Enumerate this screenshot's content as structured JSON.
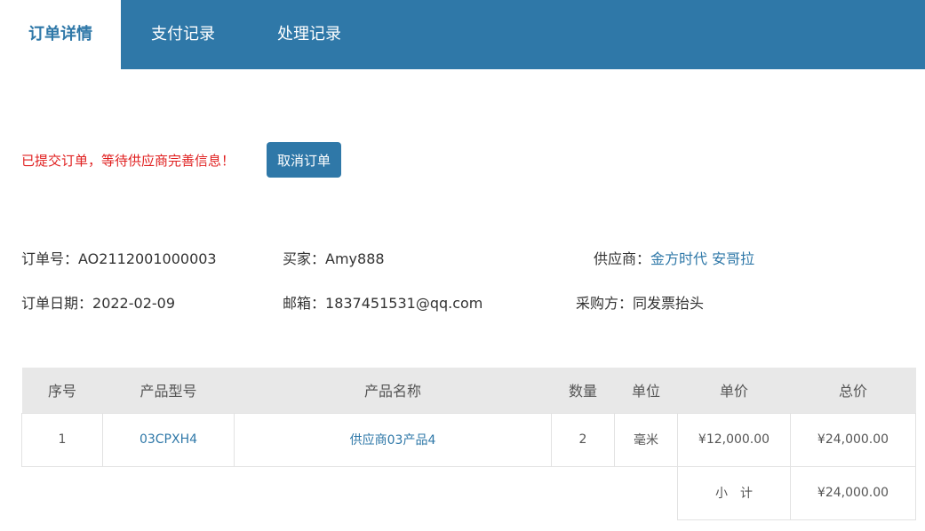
{
  "tabs": [
    {
      "label": "订单详情",
      "active": true
    },
    {
      "label": "支付记录",
      "active": false
    },
    {
      "label": "处理记录",
      "active": false
    }
  ],
  "status": {
    "message": "已提交订单，等待供应商完善信息！",
    "cancel_label": "取消订单"
  },
  "order_info": {
    "order_no_label": "订单号：",
    "order_no": "AO2112001000003",
    "buyer_label": "买家：",
    "buyer": "Amy888",
    "supplier_label": "供应商：",
    "supplier": "金方时代 安哥拉",
    "date_label": "订单日期：",
    "date": "2022-02-09",
    "email_label": "邮箱：",
    "email": "1837451531@qq.com",
    "purchaser_label": "采购方：",
    "purchaser": "同发票抬头"
  },
  "table": {
    "headers": [
      "序号",
      "产品型号",
      "产品名称",
      "数量",
      "单位",
      "单价",
      "总价"
    ],
    "rows": [
      {
        "index": "1",
        "model": "03CPXH4",
        "name": "供应商03产品4",
        "qty": "2",
        "unit": "毫米",
        "price": "¥12,000.00",
        "total": "¥24,000.00"
      }
    ],
    "subtotal_label": "小　计",
    "subtotal_value": "¥24,000.00"
  },
  "colors": {
    "primary": "#2f78a8",
    "alert": "#e02020"
  }
}
